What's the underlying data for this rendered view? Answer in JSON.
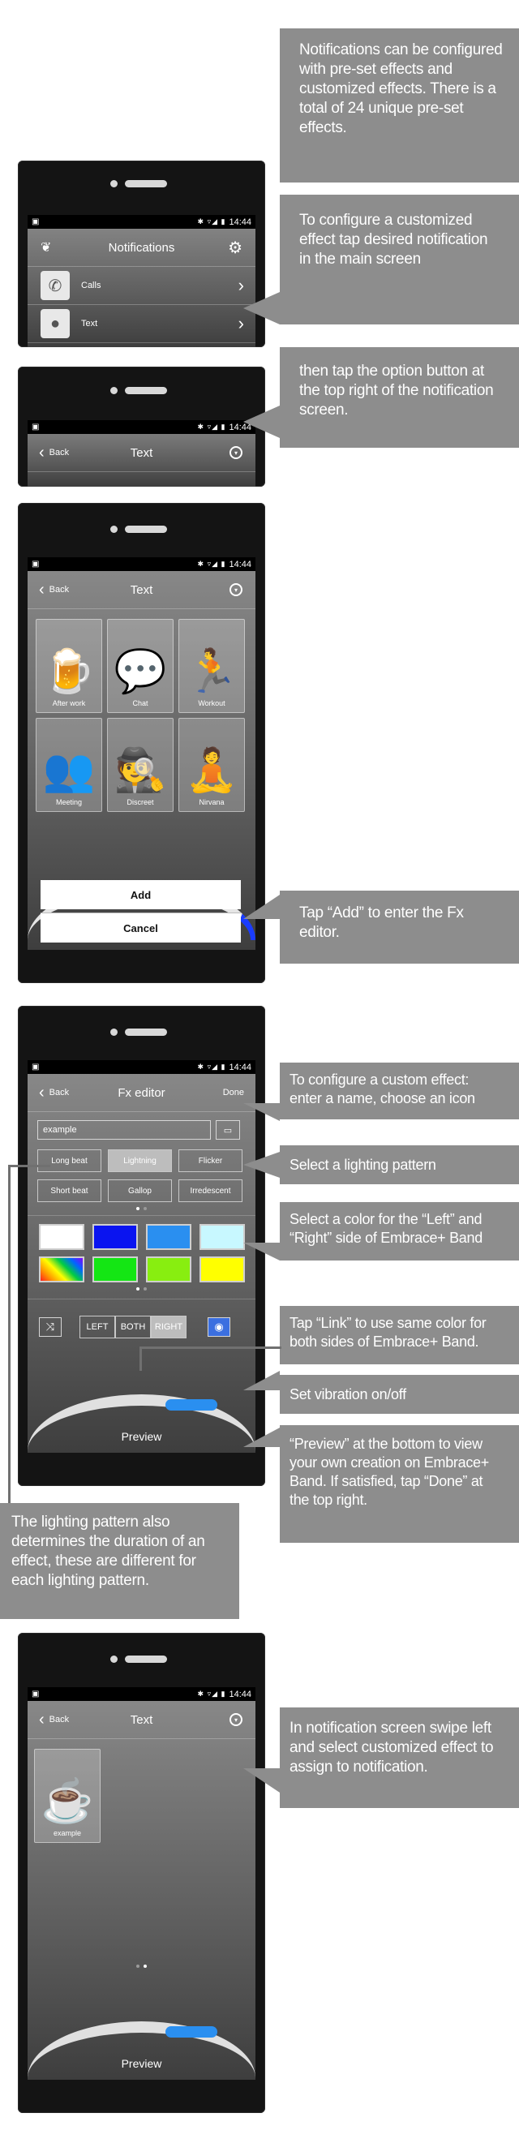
{
  "statusbar": {
    "time": "14:44",
    "icons": "✱ ▿◢ ▮"
  },
  "phone1": {
    "title": "Notifications",
    "rows": [
      {
        "label": "Calls"
      },
      {
        "label": "Text"
      }
    ]
  },
  "phone2": {
    "back": "Back",
    "title": "Text"
  },
  "phone3": {
    "back": "Back",
    "title": "Text",
    "effects": [
      {
        "label": "After work",
        "icon": "beer-mug-icon"
      },
      {
        "label": "Chat",
        "icon": "chat-people-icon"
      },
      {
        "label": "Workout",
        "icon": "treadmill-icon"
      },
      {
        "label": "Meeting",
        "icon": "meeting-icon"
      },
      {
        "label": "Discreet",
        "icon": "spy-icon"
      },
      {
        "label": "Nirvana",
        "icon": "meditation-icon"
      }
    ],
    "add_label": "Add",
    "cancel_label": "Cancel"
  },
  "phone4": {
    "back": "Back",
    "title": "Fx editor",
    "done": "Done",
    "name_value": "example",
    "patterns": [
      "Long beat",
      "Lightning",
      "Flicker",
      "Short beat",
      "Gallop",
      "Irredescent"
    ],
    "selected_pattern": "Lightning",
    "colors": [
      "#ffffff",
      "#0a14f0",
      "#2a8ff0",
      "#c8f8ff",
      "rainbow",
      "#14e614",
      "#88ee10",
      "#ffff00"
    ],
    "left": "LEFT",
    "both": "BOTH",
    "right": "RIGHT",
    "preview": "Preview"
  },
  "phone5": {
    "back": "Back",
    "title": "Text",
    "tile_label": "example",
    "preview": "Preview"
  },
  "callouts": {
    "c1": "Notifications can be configured with pre-set effects and customized effects. There is a total of 24 unique pre-set effects.",
    "c2": "To configure a customized effect tap desired notification in the main screen",
    "c3": "then tap the option button at the top right of the notification screen.",
    "c4": "Tap “Add” to enter the Fx editor.",
    "c5": "To configure a custom effect: enter a name, choose an icon",
    "c6": "Select a lighting pattern",
    "c7": "Select a color for the “Left” and “Right” side of Embrace+ Band",
    "c8": "Tap “Link” to use same color for both sides of Embrace+ Band.",
    "c9": "Set vibration on/off",
    "c10": "“Preview” at the bottom to view your own creation on Embrace+ Band. If satisfied, tap “Done” at the top right.",
    "c11": "The lighting pattern also determines the duration of an effect, these are different for each lighting pattern.",
    "c12": "In notification screen swipe left and select customized effect to assign to notification."
  }
}
